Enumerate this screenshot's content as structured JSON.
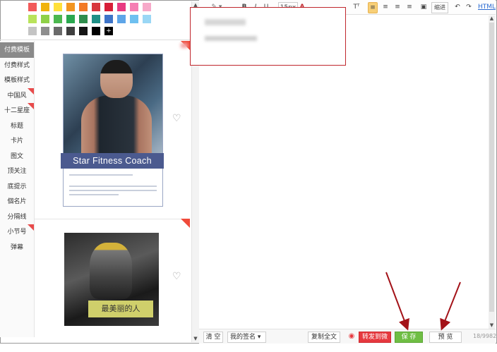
{
  "palette": {
    "colors": [
      "#f25a5a",
      "#f0b30d",
      "#ffe03b",
      "#f29520",
      "#f27a27",
      "#d8363d",
      "#d71e38",
      "#e83b82",
      "#f57eb3",
      "#f7a9c9",
      "#b9e35a",
      "#8fd147",
      "#4cb84f",
      "#2aa84f",
      "#2f8d4c",
      "#1f8f86",
      "#3e74c8",
      "#5ea5e8",
      "#6ec0f0",
      "#9ad7f5",
      "#c4c4c4",
      "#8e8e8e",
      "#6a6a6a",
      "#3f3f3f",
      "#151515",
      "#000000"
    ],
    "more_label": "+"
  },
  "sidenav": {
    "items": [
      {
        "label": "付费模板",
        "active": true,
        "new": false
      },
      {
        "label": "付费样式",
        "active": false,
        "new": false
      },
      {
        "label": "模板样式",
        "active": false,
        "new": false
      },
      {
        "label": "中国风",
        "active": false,
        "new": true
      },
      {
        "label": "十二星座",
        "active": false,
        "new": true
      },
      {
        "label": "标题",
        "active": false,
        "new": false
      },
      {
        "label": "卡片",
        "active": false,
        "new": false
      },
      {
        "label": "图文",
        "active": false,
        "new": false
      },
      {
        "label": "顶关注",
        "active": false,
        "new": false
      },
      {
        "label": "底提示",
        "active": false,
        "new": false
      },
      {
        "label": "個名片",
        "active": false,
        "new": false
      },
      {
        "label": "分隔线",
        "active": false,
        "new": false
      },
      {
        "label": "小节号",
        "active": false,
        "new": true
      },
      {
        "label": "弹幕",
        "active": false,
        "new": false
      }
    ]
  },
  "templates": {
    "card1": {
      "banner": "Star Fitness Coach",
      "heart": "♡"
    },
    "card2": {
      "banner": "最美丽的人",
      "heart": "♡"
    }
  },
  "toolbar": {
    "items": [
      "B",
      "I",
      "U",
      "15px",
      "A",
      "Tᵀ",
      "≡",
      "≡",
      "≡",
      "≡",
      "▣",
      "缩进",
      "↶",
      "↷",
      "HTML"
    ]
  },
  "bottombar": {
    "clear": "清 空",
    "signature": "我的签名 ▾",
    "copy_all": "复制全文",
    "forward_weibo": "转发到微博",
    "save": "保 存",
    "preview": "预 览",
    "counter": "18/9982"
  },
  "colors": {
    "accent_red": "#c0272d",
    "save_green": "#6fbe44",
    "nav_active": "#8a8a8a",
    "banner_blue": "#4b5a8f"
  }
}
